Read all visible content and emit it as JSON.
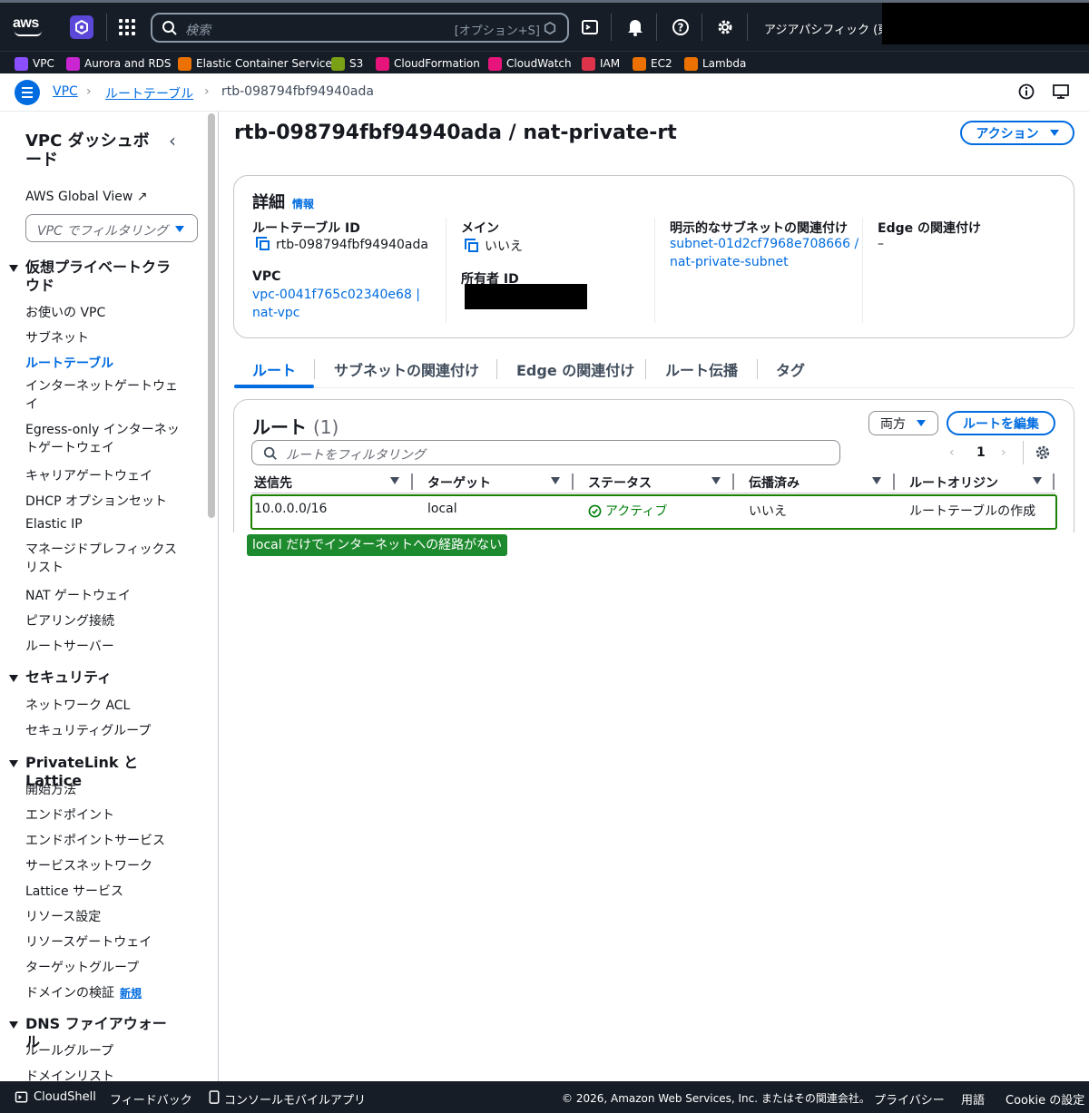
{
  "topbar": {
    "search_placeholder": "検索",
    "search_shortcut": "[オプション+S]",
    "region": "アジアパシフィック (東京)"
  },
  "favorites": [
    {
      "label": "VPC",
      "color": "#8c4fff"
    },
    {
      "label": "Aurora and RDS",
      "color": "#c925d1"
    },
    {
      "label": "Elastic Container Service",
      "color": "#ed7100"
    },
    {
      "label": "S3",
      "color": "#7aa116"
    },
    {
      "label": "CloudFormation",
      "color": "#e7157b"
    },
    {
      "label": "CloudWatch",
      "color": "#e7157b"
    },
    {
      "label": "IAM",
      "color": "#dd344c"
    },
    {
      "label": "EC2",
      "color": "#ed7100"
    },
    {
      "label": "Lambda",
      "color": "#ed7100"
    }
  ],
  "breadcrumb": {
    "items": [
      "VPC",
      "ルートテーブル",
      "rtb-098794fbf94940ada"
    ]
  },
  "sidebar": {
    "title": "VPC ダッシュボード",
    "global_view": "AWS Global View",
    "filter_placeholder": "VPC でフィルタリング",
    "sections": [
      {
        "label": "仮想プライベートクラウド",
        "items": [
          "お使いの VPC",
          "サブネット",
          "ルートテーブル",
          "インターネットゲートウェイ",
          "Egress-only インターネットゲートウェイ",
          "キャリアゲートウェイ",
          "DHCP オプションセット",
          "Elastic IP",
          "マネージドプレフィックスリスト",
          "NAT ゲートウェイ",
          "ピアリング接続",
          "ルートサーバー"
        ]
      },
      {
        "label": "セキュリティ",
        "items": [
          "ネットワーク ACL",
          "セキュリティグループ"
        ]
      },
      {
        "label": "PrivateLink と Lattice",
        "items": [
          "開始方法",
          "エンドポイント",
          "エンドポイントサービス",
          "サービスネットワーク",
          "Lattice サービス",
          "リソース設定",
          "リソースゲートウェイ",
          "ターゲットグループ",
          "ドメインの検証"
        ]
      },
      {
        "label": "DNS ファイアウォール",
        "items": [
          "ルールグループ",
          "ドメインリスト"
        ]
      }
    ],
    "new_badge": "新規"
  },
  "page": {
    "title": "rtb-098794fbf94940ada / nat-private-rt",
    "actions_label": "アクション"
  },
  "details": {
    "heading": "詳細",
    "info": "情報",
    "route_table_id_label": "ルートテーブル ID",
    "route_table_id": "rtb-098794fbf94940ada",
    "vpc_label": "VPC",
    "vpc_line1": "vpc-0041f765c02340e68 |",
    "vpc_line2": "nat-vpc",
    "main_label": "メイン",
    "main_value": "いいえ",
    "owner_label": "所有者 ID",
    "subnet_assoc_label": "明示的なサブネットの関連付け",
    "subnet_line1": "subnet-01d2cf7968e708666 /",
    "subnet_line2": "nat-private-subnet",
    "edge_label": "Edge の関連付け",
    "edge_value": "–"
  },
  "tabs": [
    "ルート",
    "サブネットの関連付け",
    "Edge の関連付け",
    "ルート伝播",
    "タグ"
  ],
  "routes": {
    "heading": "ルート",
    "count": "(1)",
    "both_label": "両方",
    "edit_label": "ルートを編集",
    "filter_placeholder": "ルートをフィルタリング",
    "page": "1",
    "columns": [
      "送信先",
      "ターゲット",
      "ステータス",
      "伝播済み",
      "ルートオリジン"
    ],
    "rows": [
      [
        "10.0.0.0/16",
        "local",
        "アクティブ",
        "いいえ",
        "ルートテーブルの作成"
      ]
    ],
    "annotation": "local だけでインターネットへの経路がない"
  },
  "footer": {
    "cloudshell": "CloudShell",
    "feedback": "フィードバック",
    "mobile": "コンソールモバイルアプリ",
    "copyright": "© 2026, Amazon Web Services, Inc. またはその関連会社。",
    "privacy": "プライバシー",
    "terms": "用語",
    "cookie": "Cookie の設定"
  }
}
